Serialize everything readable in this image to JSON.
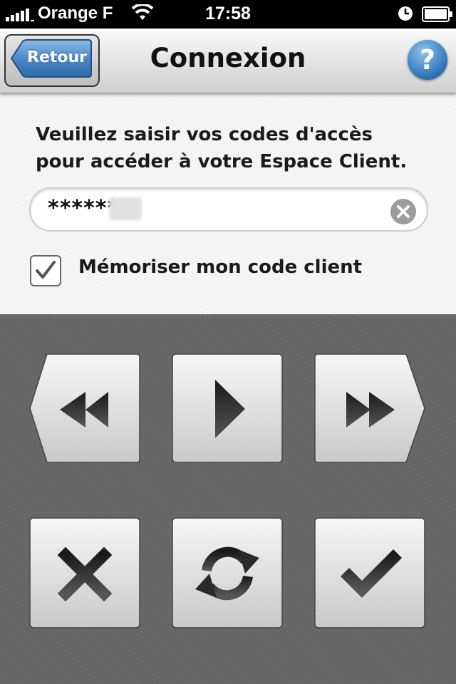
{
  "status_bar": {
    "carrier": "Orange F",
    "time": "17:58",
    "signal_icon": "signal-bars-icon",
    "wifi_icon": "wifi-icon",
    "alarm_icon": "clock-icon",
    "battery_icon": "battery-icon"
  },
  "nav": {
    "back_label": "Retour",
    "title": "Connexion",
    "help_label": "?"
  },
  "form": {
    "intro_line1": "Veuillez saisir vos codes d'accès",
    "intro_line2": "pour accéder à votre Espace Client.",
    "code_value": "******",
    "remember_label": "Mémoriser mon code client",
    "remember_checked": true
  },
  "keypad": {
    "keys": [
      {
        "name": "previous-key",
        "icon": "rewind-icon"
      },
      {
        "name": "play-key",
        "icon": "play-icon"
      },
      {
        "name": "next-key",
        "icon": "fast-forward-icon"
      },
      {
        "name": "cancel-key",
        "icon": "close-icon"
      },
      {
        "name": "refresh-key",
        "icon": "refresh-icon"
      },
      {
        "name": "validate-key",
        "icon": "checkmark-icon"
      }
    ]
  },
  "colors": {
    "accent_blue": "#3a7cc0",
    "keypad_background": "#666666",
    "key_face": "#dedede",
    "key_icon": "#333333"
  }
}
